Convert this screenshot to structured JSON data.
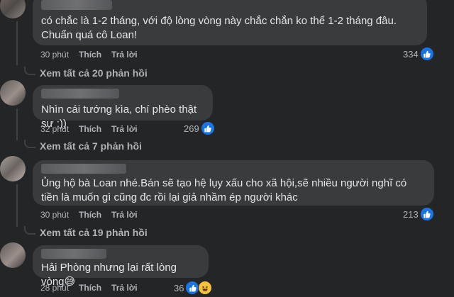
{
  "comments": [
    {
      "text": "có chắc là 1-2 tháng, với độ lòng vòng này chắc chắn ko thể 1-2 tháng đâu. Chuẩn quá cô Loan!",
      "time": "30 phút",
      "like_label": "Thích",
      "reply_label": "Trả lời",
      "reaction_count": "334",
      "view_replies": "Xem tất cả 20 phản hồi"
    },
    {
      "text": "Nhìn cái tướng kìa, chí phèo thật sự :))",
      "time": "32 phút",
      "like_label": "Thích",
      "reply_label": "Trả lời",
      "reaction_count": "269",
      "view_replies": "Xem tất cả 7 phản hồi"
    },
    {
      "text": "Ủng hộ bà Loan nhé.Bán sẽ tạo hệ lụy xấu cho xã hội,sẽ nhiều người nghĩ có tiền là muốn gì cũng đc rồi lại giả nhầm ép người khác",
      "time": "30 phút",
      "like_label": "Thích",
      "reply_label": "Trả lời",
      "reaction_count": "213",
      "view_replies": "Xem tất cả 19 phản hồi"
    },
    {
      "text": "Hải Phòng nhưng lại rất lòng vòng😅",
      "time": "28 phút",
      "like_label": "Thích",
      "reply_label": "Trả lời",
      "reaction_count": "36"
    }
  ],
  "icons": {
    "like": "like-icon",
    "haha": "haha-icon"
  },
  "colors": {
    "background": "#242526",
    "bubble": "#3a3b3c",
    "like_blue": "#1b74e4"
  }
}
